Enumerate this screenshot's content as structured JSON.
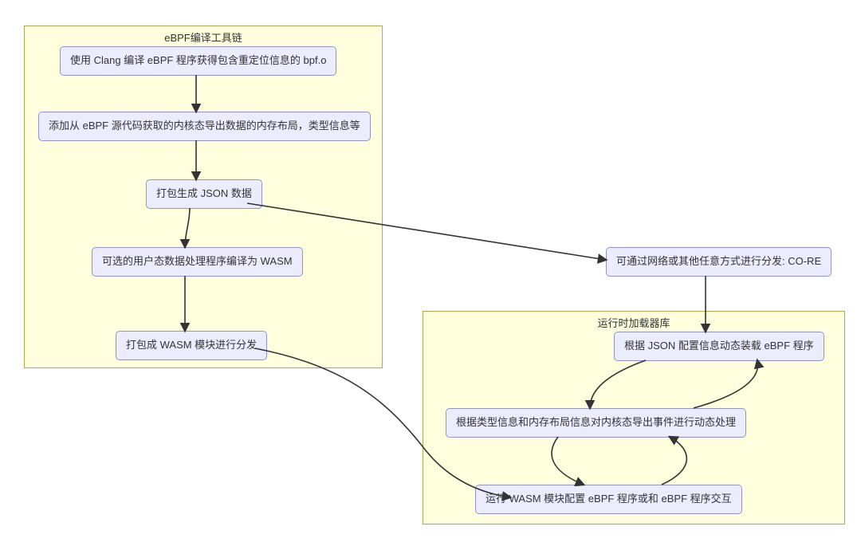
{
  "diagram": {
    "clusters": {
      "toolchain": {
        "title": "eBPF编译工具链"
      },
      "runtime": {
        "title": "运行时加载器库"
      }
    },
    "nodes": {
      "compile": "使用 Clang 编译 eBPF 程序获得包含重定位信息的 bpf.o",
      "addmeta": "添加从 eBPF 源代码获取的内核态导出数据的内存布局，类型信息等",
      "packjson": "打包生成 JSON 数据",
      "compilewasm": "可选的用户态数据处理程序编译为 WASM",
      "packwasm": "打包成 WASM 模块进行分发",
      "distribute": "可通过网络或其他任意方式进行分发: CO-RE",
      "loadjson": "根据 JSON 配置信息动态装载 eBPF 程序",
      "process": "根据类型信息和内存布局信息对内核态导出事件进行动态处理",
      "runwasm": "运行 WASM 模块配置 eBPF 程序或和 eBPF 程序交互"
    }
  }
}
